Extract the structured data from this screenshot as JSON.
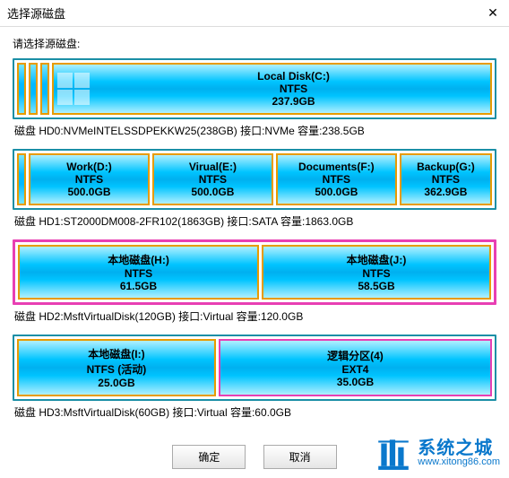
{
  "window": {
    "title": "选择源磁盘",
    "close": "✕"
  },
  "prompt": "请选择源磁盘:",
  "disks": [
    {
      "pre_bars": 3,
      "has_icon": true,
      "partitions": [
        {
          "name": "Local Disk(C:)",
          "fs": "NTFS",
          "size": "237.9GB",
          "style": "normal",
          "flex": 1
        }
      ],
      "info": "磁盘 HD0:NVMeINTELSSDPEKKW25(238GB)  接口:NVMe  容量:238.5GB",
      "selected": false
    },
    {
      "pre_bars": 1,
      "has_icon": false,
      "partitions": [
        {
          "name": "Work(D:)",
          "fs": "NTFS",
          "size": "500.0GB",
          "style": "normal",
          "flex": 1
        },
        {
          "name": "Virual(E:)",
          "fs": "NTFS",
          "size": "500.0GB",
          "style": "normal",
          "flex": 1
        },
        {
          "name": "Documents(F:)",
          "fs": "NTFS",
          "size": "500.0GB",
          "style": "normal",
          "flex": 1
        },
        {
          "name": "Backup(G:)",
          "fs": "NTFS",
          "size": "362.9GB",
          "style": "normal",
          "flex": 0.75
        }
      ],
      "info": "磁盘 HD1:ST2000DM008-2FR102(1863GB)  接口:SATA  容量:1863.0GB",
      "selected": false
    },
    {
      "pre_bars": 0,
      "has_icon": false,
      "partitions": [
        {
          "name": "本地磁盘(H:)",
          "fs": "NTFS",
          "size": "61.5GB",
          "style": "normal",
          "flex": 1
        },
        {
          "name": "本地磁盘(J:)",
          "fs": "NTFS",
          "size": "58.5GB",
          "style": "normal",
          "flex": 0.95
        }
      ],
      "info": "磁盘 HD2:MsftVirtualDisk(120GB)  接口:Virtual  容量:120.0GB",
      "selected": true
    },
    {
      "pre_bars": 0,
      "has_icon": false,
      "partitions": [
        {
          "name": "本地磁盘(I:)",
          "fs": "NTFS (活动)",
          "size": "25.0GB",
          "style": "normal",
          "flex": 0.72
        },
        {
          "name": "逻辑分区(4)",
          "fs": "EXT4",
          "size": "35.0GB",
          "style": "magenta",
          "flex": 1
        }
      ],
      "info": "磁盘 HD3:MsftVirtualDisk(60GB)  接口:Virtual  容量:60.0GB",
      "selected": false
    }
  ],
  "buttons": {
    "ok": "确定",
    "cancel": "取消"
  },
  "watermark": {
    "cn": "系统之城",
    "url": "www.xitong86.com"
  }
}
